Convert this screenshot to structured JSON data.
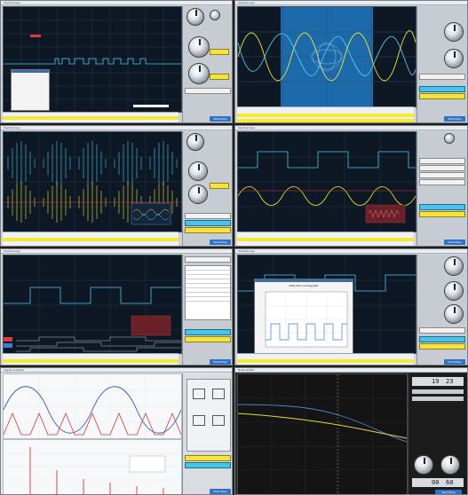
{
  "colors": {
    "screen_bg": "#0d1824",
    "channel1": "#f1e63a",
    "channel2": "#4ec5ee",
    "marker_red": "#e03a3a",
    "button_blue": "#2f73c8"
  },
  "panels": [
    {
      "title": "Oscilloscope",
      "side_button": "Start/Stop"
    },
    {
      "title": "Oscilloscope",
      "side_button": "Start/Stop"
    },
    {
      "title": "Oscilloscope",
      "side_button": "Start/Stop"
    },
    {
      "title": "Oscilloscope",
      "side_button": "Start/Stop"
    },
    {
      "title": "Oscilloscope",
      "side_button": "Start/Stop"
    },
    {
      "title": "Oscilloscope",
      "side_button": "Start/Stop"
    },
    {
      "title": "Signal analyzer",
      "side_button": "Start/Stop"
    },
    {
      "title": "Bode plotter",
      "side_button": "Start/Stop"
    }
  ],
  "popup": {
    "title": "Advanced trigger"
  },
  "plot_window": {
    "title": "DSO-XXX oscillograph"
  },
  "readout": {
    "left": "19",
    "right": "23",
    "left2": "00",
    "right2": "60"
  },
  "icons": [
    "knob-icon",
    "trigger-marker-icon",
    "cursor-marker-icon"
  ]
}
